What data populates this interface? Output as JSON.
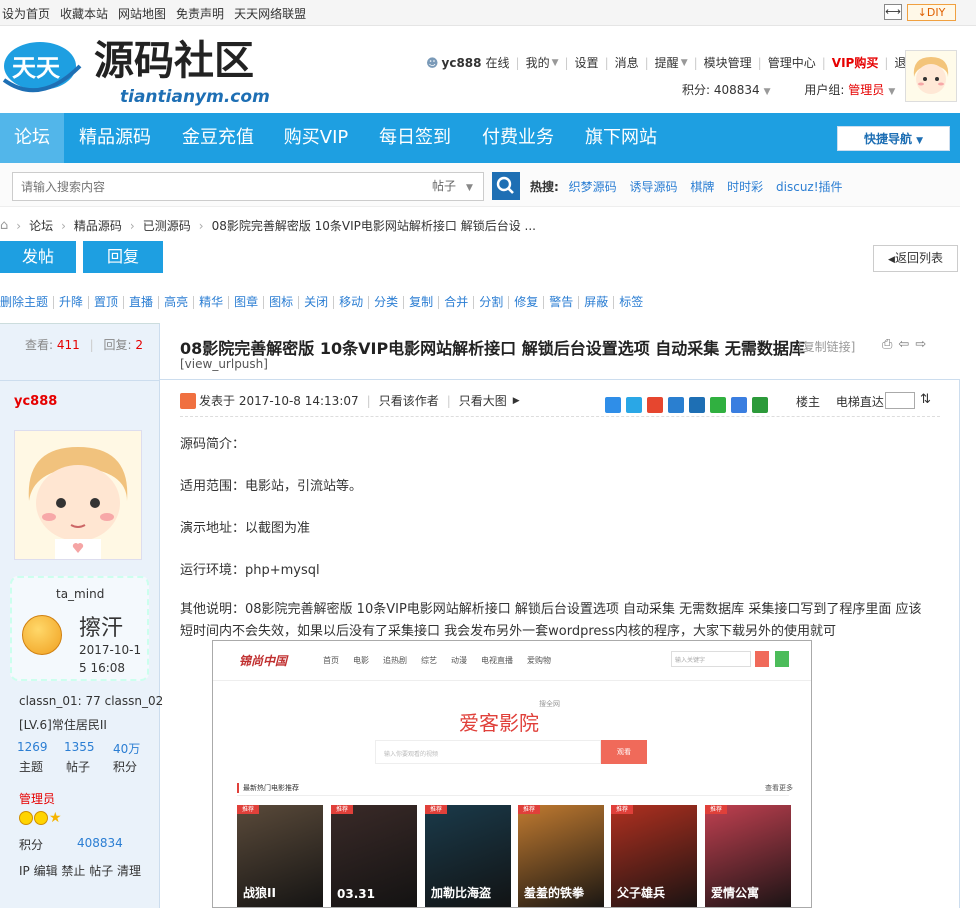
{
  "topbar": {
    "links": [
      "设为首页",
      "收藏本站",
      "网站地图",
      "免责声明",
      "天天网络联盟"
    ],
    "diy_label": "DIY"
  },
  "logo": {
    "badge": "天天",
    "name": "源码社区",
    "domain": "tiantianym.com"
  },
  "userbar": {
    "username": "yc888",
    "status": "在线",
    "items": [
      "我的",
      "设置",
      "消息",
      "提醒",
      "模块管理",
      "管理中心",
      "VIP购买",
      "退出"
    ],
    "points_label": "积分: 408834",
    "group_label": "用户组:",
    "group_value": "管理员"
  },
  "nav": {
    "items": [
      "论坛",
      "精品源码",
      "金豆充值",
      "购买VIP",
      "每日签到",
      "付费业务",
      "旗下网站"
    ],
    "quick_nav": "快捷导航"
  },
  "search": {
    "placeholder": "请输入搜索内容",
    "type": "帖子",
    "hot_label": "热搜:",
    "hot_items": [
      "织梦源码",
      "诱导源码",
      "棋牌",
      "时时彩",
      "discuz!插件"
    ]
  },
  "breadcrumb": [
    "论坛",
    "精品源码",
    "已测源码",
    "08影院完善解密版 10条VIP电影网站解析接口 解锁后台设 ..."
  ],
  "actions": {
    "post": "发帖",
    "reply": "回复",
    "back": "返回列表"
  },
  "mod_tools": [
    "删除主题",
    "升降",
    "置顶",
    "直播",
    "高亮",
    "精华",
    "图章",
    "图标",
    "关闭",
    "移动",
    "分类",
    "复制",
    "合并",
    "分割",
    "修复",
    "警告",
    "屏蔽",
    "标签"
  ],
  "thread": {
    "views_label": "查看:",
    "views": "411",
    "replies_label": "回复:",
    "replies": "2",
    "title": "08影院完善解密版 10条VIP电影网站解析接口 解锁后台设置选项 自动采集 无需数据库",
    "copy_link": "[复制链接]",
    "url_push": "[view_urlpush]"
  },
  "author": {
    "name": "yc888",
    "mood_user": "ta_mind",
    "mood_text": "擦汗",
    "mood_date": "2017-10-15 16:08",
    "classn": "classn_01: 77 classn_02",
    "level": "[LV.6]常住居民II",
    "stats": [
      {
        "num": "1269",
        "label": "主题"
      },
      {
        "num": "1355",
        "label": "帖子"
      },
      {
        "num": "40万",
        "label": "积分"
      }
    ],
    "role": "管理员",
    "points_label": "积分",
    "points": "408834",
    "admin_actions": "IP 编辑 禁止 帖子 清理"
  },
  "post": {
    "posted_at": "发表于 2017-10-8 14:13:07",
    "author_only": "只看该作者",
    "big_images": "只看大图",
    "floor_owner": "楼主",
    "floor_jump": "电梯直达",
    "intro": "源码简介：",
    "scope": "适用范围：电影站，引流站等。",
    "demo": "演示地址：以截图为准",
    "env": "运行环境：php+mysql",
    "other": "其他说明：08影院完善解密版 10条VIP电影网站解析接口 解锁后台设置选项 自动采集 无需数据库 采集接口写到了程序里面 应该短时间内不会失效，如果以后没有了采集接口 我会发布另外一套wordpress内核的程序，大家下载另外的使用就可"
  },
  "embed": {
    "logo": "锦尚中国",
    "menu": [
      "首页",
      "电影",
      "追热剧",
      "综艺",
      "动漫",
      "电视直播",
      "爱购物"
    ],
    "search_placeholder": "输入关键字",
    "brand": "爱客影院",
    "brand_sub": "搜全网",
    "input_placeholder": "输入你要观看的视频",
    "button": "观看",
    "section": "最新热门电影推荐",
    "more": "查看更多",
    "poster_tag": "推荐",
    "posters": [
      "战狼II",
      "03.31",
      "加勒比海盗",
      "羞羞的铁拳",
      "父子雄兵",
      "爱情公寓"
    ],
    "poster_colors": [
      "#5a4a3a",
      "#3a2a28",
      "#1a3a4a",
      "#c07a30",
      "#b03020",
      "#c04050"
    ]
  },
  "colors": {
    "nav": "#1e9fe1",
    "link": "#2b7ed3",
    "red": "#e60000"
  }
}
